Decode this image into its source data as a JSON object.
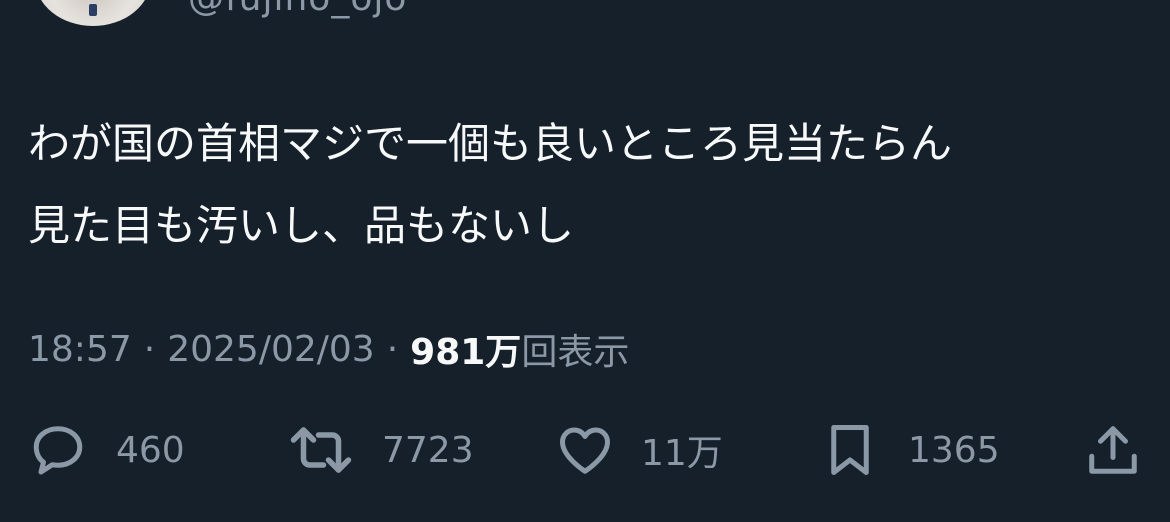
{
  "author": {
    "handle": "@fujino_ojo"
  },
  "tweet": {
    "lines": [
      "わが国の首相マジで一個も良いところ見当たらん",
      "見た目も汚いし、品もないし"
    ],
    "time": "18:57",
    "date": "2025/02/03",
    "views_count": "981万",
    "views_label": "回表示"
  },
  "actions": {
    "reply": {
      "icon": "reply-icon",
      "count": "460"
    },
    "repost": {
      "icon": "repost-icon",
      "count": "7723"
    },
    "like": {
      "icon": "heart-icon",
      "count": "11万"
    },
    "bookmark": {
      "icon": "bookmark-icon",
      "count": "1365"
    },
    "share": {
      "icon": "share-icon"
    }
  },
  "colors": {
    "background": "#15202b",
    "text": "#f7f9f9",
    "muted": "#8b98a5"
  }
}
